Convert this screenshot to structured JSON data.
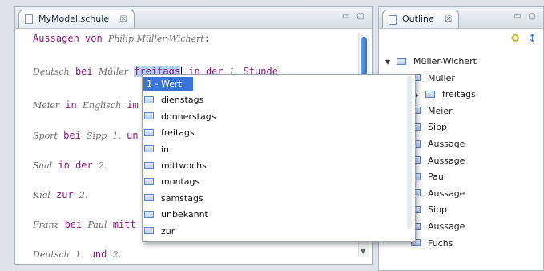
{
  "editor": {
    "tab_title": "MyModel.schule",
    "tab_close": "☒",
    "window_controls": "▭ ▢",
    "lines": [
      {
        "parts": [
          {
            "t": "Aussagen von ",
            "c": "kw"
          },
          {
            "t": "Philip Müller-Wichert",
            "c": "id"
          },
          {
            "t": ":",
            "c": "kw"
          }
        ]
      },
      {
        "parts": [
          {
            "t": "Deutsch",
            "c": "id"
          },
          {
            "t": " bei ",
            "c": "kw"
          },
          {
            "t": "Müller",
            "c": "id"
          },
          {
            "t": " ",
            "c": "kw"
          },
          {
            "t": "freitags",
            "c": "selected"
          },
          {
            "t": "",
            "c": "caret"
          },
          {
            "t": " in der ",
            "c": "kw"
          },
          {
            "t": "1.",
            "c": "id"
          },
          {
            "t": " Stunde",
            "c": "kw"
          }
        ]
      },
      {
        "parts": [
          {
            "t": "Meier",
            "c": "id"
          },
          {
            "t": " in ",
            "c": "kw"
          },
          {
            "t": "Englisch",
            "c": "id"
          },
          {
            "t": " im",
            "c": "kw"
          }
        ]
      },
      {
        "parts": [
          {
            "t": "Sport",
            "c": "id"
          },
          {
            "t": " bei ",
            "c": "kw"
          },
          {
            "t": "Sipp",
            "c": "id"
          },
          {
            "t": " ",
            "c": "kw"
          },
          {
            "t": "1.",
            "c": "id"
          },
          {
            "t": " un",
            "c": "kw"
          }
        ]
      },
      {
        "parts": [
          {
            "t": "Saal",
            "c": "id"
          },
          {
            "t": " in der ",
            "c": "kw"
          },
          {
            "t": "2.",
            "c": "id"
          }
        ]
      },
      {
        "parts": [
          {
            "t": "Kiel",
            "c": "id"
          },
          {
            "t": " zur ",
            "c": "kw"
          },
          {
            "t": "2.",
            "c": "id"
          }
        ]
      },
      {
        "parts": [
          {
            "t": "Franz",
            "c": "id"
          },
          {
            "t": " bei ",
            "c": "kw"
          },
          {
            "t": "Paul",
            "c": "id"
          },
          {
            "t": " mitt",
            "c": "kw"
          }
        ]
      },
      {
        "parts": [
          {
            "t": "Deutsch",
            "c": "id"
          },
          {
            "t": " ",
            "c": "kw"
          },
          {
            "t": "1.",
            "c": "id"
          },
          {
            "t": " und ",
            "c": "kw"
          },
          {
            "t": "2.",
            "c": "id"
          }
        ]
      }
    ]
  },
  "popup": {
    "items": [
      "1 - Wert",
      "dienstags",
      "donnerstags",
      "freitags",
      "in",
      "mittwochs",
      "montags",
      "samstags",
      "unbekannt",
      "zur"
    ]
  },
  "outline": {
    "tab_title": "Outline",
    "tab_close": "☒",
    "window_controls": "▭ ▢",
    "tree": [
      {
        "label": "Müller-Wichert",
        "level": 0,
        "twisty": "open"
      },
      {
        "label": "Müller",
        "level": 1,
        "twisty": "none"
      },
      {
        "label": "freitags",
        "level": 2,
        "twisty": "closed"
      },
      {
        "label": "Meier",
        "level": 1,
        "twisty": "none"
      },
      {
        "label": "Sipp",
        "level": 1,
        "twisty": "none"
      },
      {
        "label": "Aussage",
        "level": 1,
        "twisty": "none"
      },
      {
        "label": "Aussage",
        "level": 1,
        "twisty": "none"
      },
      {
        "label": "Paul",
        "level": 1,
        "twisty": "none"
      },
      {
        "label": "Aussage",
        "level": 1,
        "twisty": "none"
      },
      {
        "label": "Sipp",
        "level": 1,
        "twisty": "none"
      },
      {
        "label": "Aussage",
        "level": 1,
        "twisty": "none"
      },
      {
        "label": "Fuchs",
        "level": 1,
        "twisty": "none"
      }
    ]
  },
  "colors": {
    "keyword": "#8b1a7e",
    "selection": "#b8d4f5",
    "popup_highlight": "#3875d7"
  },
  "icons": {
    "sort_icon": "sort-alpha-icon",
    "filter_icon": "filter-icon"
  }
}
